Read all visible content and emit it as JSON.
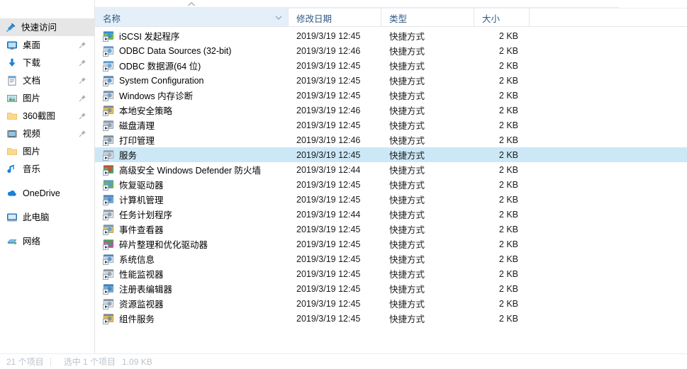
{
  "nav_pane": {
    "root": {
      "label": "快速访问",
      "icon": "pin-star-icon",
      "selected": true
    },
    "quick_access_items": [
      {
        "label": "桌面",
        "icon": "desktop-icon",
        "pinned": true
      },
      {
        "label": "下载",
        "icon": "download-icon",
        "pinned": true
      },
      {
        "label": "文档",
        "icon": "document-icon",
        "pinned": true
      },
      {
        "label": "图片",
        "icon": "pictures-icon",
        "pinned": true
      },
      {
        "label": "360截图",
        "icon": "folder-icon",
        "pinned": true
      },
      {
        "label": "视频",
        "icon": "video-icon",
        "pinned": true
      },
      {
        "label": "图片",
        "icon": "folder-icon",
        "pinned": false
      },
      {
        "label": "音乐",
        "icon": "music-note-icon",
        "pinned": false
      }
    ],
    "other_items": [
      {
        "label": "OneDrive",
        "icon": "onedrive-cloud-icon"
      },
      {
        "label": "此电脑",
        "icon": "this-pc-icon"
      },
      {
        "label": "网络",
        "icon": "network-icon"
      }
    ]
  },
  "columns": {
    "name": {
      "label": "名称",
      "sorted": true,
      "sort_direction": "ascending",
      "has_dropdown": true
    },
    "date": {
      "label": "修改日期",
      "sorted": false
    },
    "type": {
      "label": "类型",
      "sorted": false
    },
    "size": {
      "label": "大小",
      "sorted": false
    }
  },
  "files": [
    {
      "name": "iSCSI 发起程序",
      "date": "2019/3/19 12:45",
      "type": "快捷方式",
      "size": "2 KB",
      "icon": "iscsi-shortcut-icon",
      "selected": false
    },
    {
      "name": "ODBC Data Sources (32-bit)",
      "date": "2019/3/19 12:46",
      "type": "快捷方式",
      "size": "2 KB",
      "icon": "odbc-shortcut-icon",
      "selected": false
    },
    {
      "name": "ODBC 数据源(64 位)",
      "date": "2019/3/19 12:45",
      "type": "快捷方式",
      "size": "2 KB",
      "icon": "odbc-shortcut-icon",
      "selected": false
    },
    {
      "name": "System Configuration",
      "date": "2019/3/19 12:45",
      "type": "快捷方式",
      "size": "2 KB",
      "icon": "msconfig-shortcut-icon",
      "selected": false
    },
    {
      "name": "Windows 内存诊断",
      "date": "2019/3/19 12:45",
      "type": "快捷方式",
      "size": "2 KB",
      "icon": "memdiag-shortcut-icon",
      "selected": false
    },
    {
      "name": "本地安全策略",
      "date": "2019/3/19 12:46",
      "type": "快捷方式",
      "size": "2 KB",
      "icon": "secpol-shortcut-icon",
      "selected": false
    },
    {
      "name": "磁盘清理",
      "date": "2019/3/19 12:45",
      "type": "快捷方式",
      "size": "2 KB",
      "icon": "cleanmgr-shortcut-icon",
      "selected": false
    },
    {
      "name": "打印管理",
      "date": "2019/3/19 12:46",
      "type": "快捷方式",
      "size": "2 KB",
      "icon": "printmgmt-shortcut-icon",
      "selected": false
    },
    {
      "name": "服务",
      "date": "2019/3/19 12:45",
      "type": "快捷方式",
      "size": "2 KB",
      "icon": "services-shortcut-icon",
      "selected": true
    },
    {
      "name": "高级安全 Windows Defender 防火墙",
      "date": "2019/3/19 12:44",
      "type": "快捷方式",
      "size": "2 KB",
      "icon": "firewall-shortcut-icon",
      "selected": false
    },
    {
      "name": "恢复驱动器",
      "date": "2019/3/19 12:45",
      "type": "快捷方式",
      "size": "2 KB",
      "icon": "recoverydrive-shortcut-icon",
      "selected": false
    },
    {
      "name": "计算机管理",
      "date": "2019/3/19 12:45",
      "type": "快捷方式",
      "size": "2 KB",
      "icon": "compmgmt-shortcut-icon",
      "selected": false
    },
    {
      "name": "任务计划程序",
      "date": "2019/3/19 12:44",
      "type": "快捷方式",
      "size": "2 KB",
      "icon": "taskscheduler-shortcut-icon",
      "selected": false
    },
    {
      "name": "事件查看器",
      "date": "2019/3/19 12:45",
      "type": "快捷方式",
      "size": "2 KB",
      "icon": "eventviewer-shortcut-icon",
      "selected": false
    },
    {
      "name": "碎片整理和优化驱动器",
      "date": "2019/3/19 12:45",
      "type": "快捷方式",
      "size": "2 KB",
      "icon": "defrag-shortcut-icon",
      "selected": false
    },
    {
      "name": "系统信息",
      "date": "2019/3/19 12:45",
      "type": "快捷方式",
      "size": "2 KB",
      "icon": "sysinfo-shortcut-icon",
      "selected": false
    },
    {
      "name": "性能监视器",
      "date": "2019/3/19 12:45",
      "type": "快捷方式",
      "size": "2 KB",
      "icon": "perfmon-shortcut-icon",
      "selected": false
    },
    {
      "name": "注册表编辑器",
      "date": "2019/3/19 12:45",
      "type": "快捷方式",
      "size": "2 KB",
      "icon": "regedit-shortcut-icon",
      "selected": false
    },
    {
      "name": "资源监视器",
      "date": "2019/3/19 12:45",
      "type": "快捷方式",
      "size": "2 KB",
      "icon": "resmon-shortcut-icon",
      "selected": false
    },
    {
      "name": "组件服务",
      "date": "2019/3/19 12:45",
      "type": "快捷方式",
      "size": "2 KB",
      "icon": "dcomcnfg-shortcut-icon",
      "selected": false
    }
  ],
  "status_bar": {
    "item_count": "21 个项目",
    "selection": "选中 1 个项目",
    "selection_size": "1.09 KB"
  },
  "colors": {
    "selection_blue": "#cce8f7",
    "header_name_bg": "#e4eff9",
    "header_text": "#2f5a86",
    "nav_selected_bg": "#e6e6e6"
  }
}
